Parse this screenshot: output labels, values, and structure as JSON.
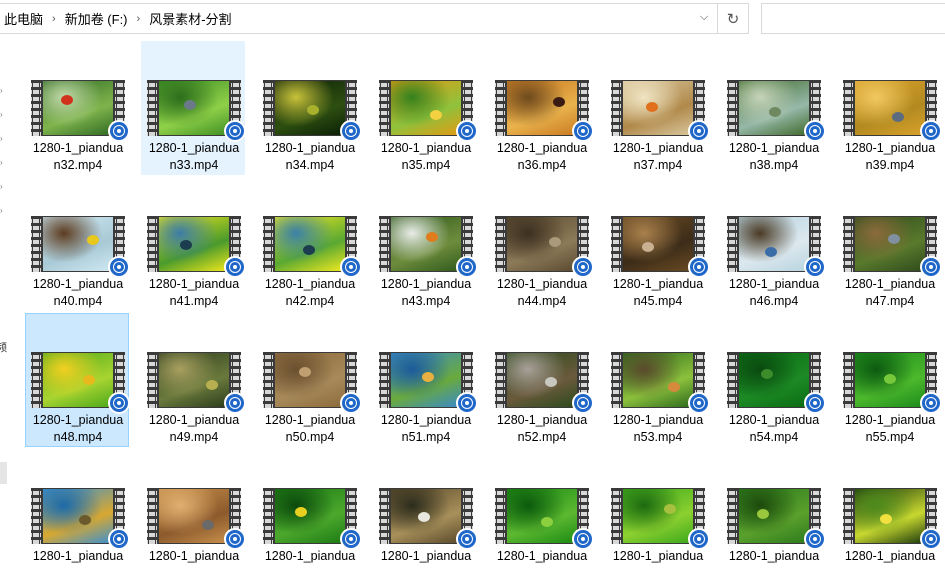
{
  "breadcrumb": {
    "items": [
      "此电脑",
      "新加卷 (F:)",
      "风景素材-分割"
    ]
  },
  "search": {
    "placeholder": ""
  },
  "icons": {
    "dropdown": "chevron-down-icon",
    "refresh": "refresh-icon",
    "badge": "media-player-badge-icon"
  },
  "files": [
    {
      "line1": "1280-1_piandua",
      "line2": "n32.mp4",
      "state": "",
      "colors": [
        "#2f6a24",
        "#7fb44c",
        "#c0d8a8"
      ],
      "subject": "#d1321c"
    },
    {
      "line1": "1280-1_piandua",
      "line2": "n33.mp4",
      "state": "hover",
      "colors": [
        "#3f8f25",
        "#8fd048",
        "#2d6e1c"
      ],
      "subject": "#6a7a8a"
    },
    {
      "line1": "1280-1_piandua",
      "line2": "n34.mp4",
      "state": "",
      "colors": [
        "#0c1f07",
        "#2d4f10",
        "#c8c23a"
      ],
      "subject": "#a8b02c"
    },
    {
      "line1": "1280-1_piandua",
      "line2": "n35.mp4",
      "state": "",
      "colors": [
        "#e29a14",
        "#8fc23c",
        "#35821e"
      ],
      "subject": "#f2d040"
    },
    {
      "line1": "1280-1_piandua",
      "line2": "n36.mp4",
      "state": "",
      "colors": [
        "#c97b22",
        "#e9b24c",
        "#6e4a1e"
      ],
      "subject": "#3a1c14"
    },
    {
      "line1": "1280-1_piandua",
      "line2": "n37.mp4",
      "state": "",
      "colors": [
        "#d9c79e",
        "#b0894a",
        "#f0e4c2"
      ],
      "subject": "#e0701c"
    },
    {
      "line1": "1280-1_piandua",
      "line2": "n38.mp4",
      "state": "",
      "colors": [
        "#3f6a2c",
        "#96b8a8",
        "#c6d4b8"
      ],
      "subject": "#6f8860"
    },
    {
      "line1": "1280-1_piandua",
      "line2": "n39.mp4",
      "state": "",
      "colors": [
        "#d9a22c",
        "#b28a20",
        "#f0c860"
      ],
      "subject": "#5c6b80"
    },
    {
      "line1": "1280-1_piandua",
      "line2": "n40.mp4",
      "state": "",
      "colors": [
        "#cfe8f2",
        "#a8c9d6",
        "#5c3c20"
      ],
      "subject": "#e8c81c"
    },
    {
      "line1": "1280-1_piandua",
      "line2": "n41.mp4",
      "state": "",
      "colors": [
        "#f0e81c",
        "#4a9a2c",
        "#3c7ca8"
      ],
      "subject": "#1c3c50"
    },
    {
      "line1": "1280-1_piandua",
      "line2": "n42.mp4",
      "state": "",
      "colors": [
        "#f2ea20",
        "#59a832",
        "#3a80a8"
      ],
      "subject": "#1c3c50"
    },
    {
      "line1": "1280-1_piandua",
      "line2": "n43.mp4",
      "state": "",
      "colors": [
        "#2f5a1c",
        "#6e8c3c",
        "#e8ece8"
      ],
      "subject": "#e07c1c"
    },
    {
      "line1": "1280-1_piandua",
      "line2": "n44.mp4",
      "state": "",
      "colors": [
        "#5a4a30",
        "#8c7a58",
        "#3c3020"
      ],
      "subject": "#a89a7a"
    },
    {
      "line1": "1280-1_piandua",
      "line2": "n45.mp4",
      "state": "",
      "colors": [
        "#6a4a24",
        "#3c2c18",
        "#a8804c"
      ],
      "subject": "#c8b090"
    },
    {
      "line1": "1280-1_piandua",
      "line2": "n46.mp4",
      "state": "",
      "colors": [
        "#b8d4e0",
        "#dce8ee",
        "#4a3a24"
      ],
      "subject": "#3a6ca8"
    },
    {
      "line1": "1280-1_piandua",
      "line2": "n47.mp4",
      "state": "",
      "colors": [
        "#2f4a1c",
        "#5a7a2c",
        "#8c6a3c"
      ],
      "subject": "#8090a0"
    },
    {
      "line1": "1280-1_piandua",
      "line2": "n48.mp4",
      "state": "selected",
      "colors": [
        "#4ca81c",
        "#a8d430",
        "#f2d020"
      ],
      "subject": "#e8b81c"
    },
    {
      "line1": "1280-1_piandua",
      "line2": "n49.mp4",
      "state": "",
      "colors": [
        "#2c3c1c",
        "#6a7a3c",
        "#a8a060"
      ],
      "subject": "#b8b050"
    },
    {
      "line1": "1280-1_piandua",
      "line2": "n50.mp4",
      "state": "",
      "colors": [
        "#8c6a3c",
        "#a88a5a",
        "#6a5030"
      ],
      "subject": "#c0a070"
    },
    {
      "line1": "1280-1_piandua",
      "line2": "n51.mp4",
      "state": "",
      "colors": [
        "#3a8ac8",
        "#6aaa3c",
        "#1c5a9a"
      ],
      "subject": "#e8b040"
    },
    {
      "line1": "1280-1_piandua",
      "line2": "n52.mp4",
      "state": "",
      "colors": [
        "#2c4a1c",
        "#6a5a3c",
        "#a8a098"
      ],
      "subject": "#c8c8c0"
    },
    {
      "line1": "1280-1_piandua",
      "line2": "n53.mp4",
      "state": "",
      "colors": [
        "#2c6a1c",
        "#8cc03c",
        "#5a4a2c"
      ],
      "subject": "#d88a3c"
    },
    {
      "line1": "1280-1_piandua",
      "line2": "n54.mp4",
      "state": "",
      "colors": [
        "#0c6a14",
        "#1c8a24",
        "#0a4a10"
      ],
      "subject": "#3c8c2c"
    },
    {
      "line1": "1280-1_piandua",
      "line2": "n55.mp4",
      "state": "",
      "colors": [
        "#1c8a1c",
        "#4cb82c",
        "#0c5a10"
      ],
      "subject": "#78c83c"
    },
    {
      "line1": "1280-1_piandua",
      "line2": "",
      "state": "",
      "colors": [
        "#3c90d0",
        "#d8a830",
        "#1c6aa8"
      ],
      "subject": "#6a5a2c"
    },
    {
      "line1": "1280-1_piandua",
      "line2": "",
      "state": "",
      "colors": [
        "#c8904c",
        "#8c5a2c",
        "#e0b070"
      ],
      "subject": "#6a6a6a"
    },
    {
      "line1": "1280-1_piandua",
      "line2": "",
      "state": "",
      "colors": [
        "#1c7a14",
        "#4ca82c",
        "#0c4a0c"
      ],
      "subject": "#e8d020"
    },
    {
      "line1": "1280-1_piandua",
      "line2": "",
      "state": "",
      "colors": [
        "#5a4a2c",
        "#a8905a",
        "#2c2c1c"
      ],
      "subject": "#e8e8e0"
    },
    {
      "line1": "1280-1_piandua",
      "line2": "",
      "state": "",
      "colors": [
        "#1c8a14",
        "#5cb830",
        "#0c5a0c"
      ],
      "subject": "#8cd040"
    },
    {
      "line1": "1280-1_piandua",
      "line2": "",
      "state": "",
      "colors": [
        "#3ca81c",
        "#8cd030",
        "#1c6a10"
      ],
      "subject": "#a8c040"
    },
    {
      "line1": "1280-1_piandua",
      "line2": "",
      "state": "",
      "colors": [
        "#2c7a1c",
        "#5aa02c",
        "#1c4a0c"
      ],
      "subject": "#9ac83c"
    },
    {
      "line1": "1280-1_piandua",
      "line2": "",
      "state": "",
      "colors": [
        "#1c3a0c",
        "#c8d830",
        "#4c8a1c"
      ],
      "subject": "#f0e040"
    }
  ]
}
